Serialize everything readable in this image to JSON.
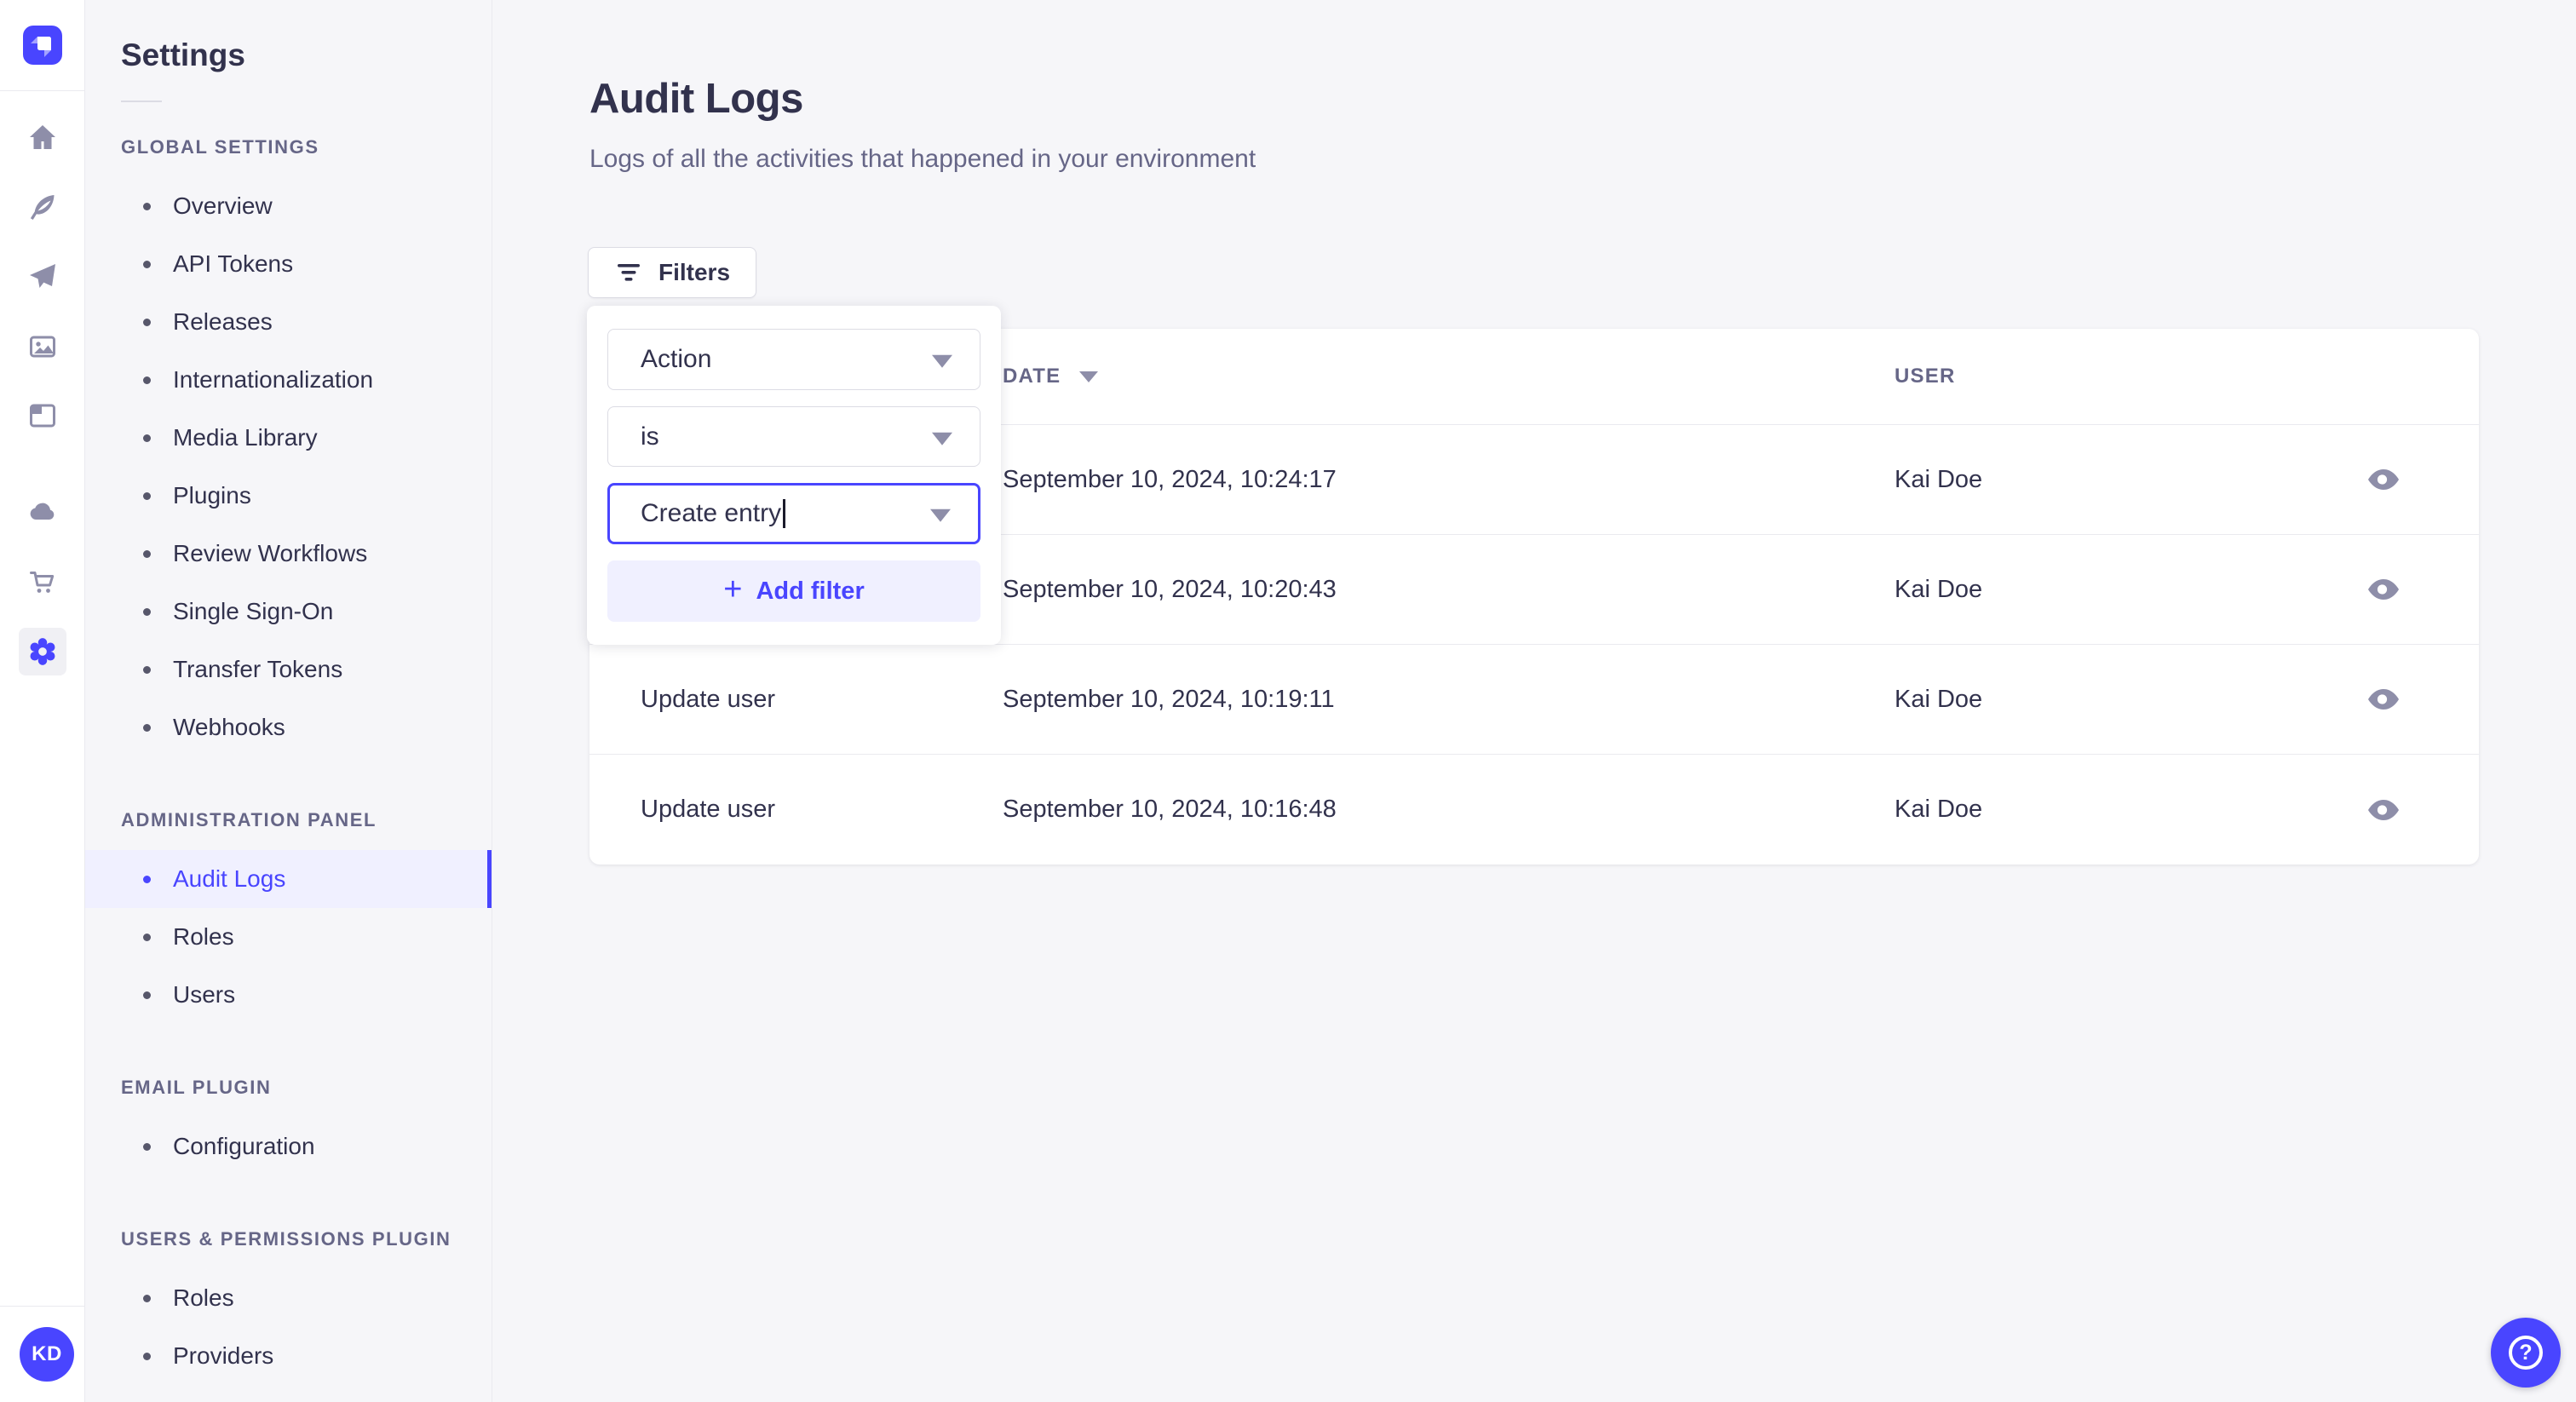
{
  "colors": {
    "accent": "#4945ff",
    "accent_light": "#f0f0ff",
    "text": "#32324d",
    "text_muted": "#666687",
    "border": "#dcdce4",
    "divider": "#eaeaef",
    "background": "#f6f6f9",
    "icon_gray": "#8e8ea9",
    "surface": "#ffffff"
  },
  "rail": {
    "logo_icon": "strapi-logo",
    "icons": [
      "home-icon",
      "feather-icon",
      "paper-plane-icon",
      "media-library-icon",
      "layout-icon",
      "cloud-icon",
      "cart-icon",
      "gear-icon"
    ],
    "active_icon": "gear-icon",
    "avatar_initials": "KD"
  },
  "sidebar": {
    "title": "Settings",
    "sections": [
      {
        "label": "GLOBAL SETTINGS",
        "items": [
          {
            "label": "Overview"
          },
          {
            "label": "API Tokens"
          },
          {
            "label": "Releases"
          },
          {
            "label": "Internationalization"
          },
          {
            "label": "Media Library"
          },
          {
            "label": "Plugins"
          },
          {
            "label": "Review Workflows"
          },
          {
            "label": "Single Sign-On"
          },
          {
            "label": "Transfer Tokens"
          },
          {
            "label": "Webhooks"
          }
        ]
      },
      {
        "label": "ADMINISTRATION PANEL",
        "items": [
          {
            "label": "Audit Logs",
            "active": true
          },
          {
            "label": "Roles"
          },
          {
            "label": "Users"
          }
        ]
      },
      {
        "label": "EMAIL PLUGIN",
        "items": [
          {
            "label": "Configuration"
          }
        ]
      },
      {
        "label": "USERS & PERMISSIONS PLUGIN",
        "items": [
          {
            "label": "Roles"
          },
          {
            "label": "Providers"
          }
        ]
      }
    ]
  },
  "main": {
    "title": "Audit Logs",
    "subtitle": "Logs of all the activities that happened in your environment",
    "filters_label": "Filters"
  },
  "filter_popover": {
    "field_value": "Action",
    "operator_value": "is",
    "value_value": "Create entry",
    "add_filter_label": "Add filter"
  },
  "table": {
    "headers": {
      "date": "DATE",
      "user": "USER"
    },
    "sorted_column": "DATE",
    "rows": [
      {
        "action": "",
        "date": "September 10, 2024, 10:24:17",
        "user": "Kai Doe"
      },
      {
        "action": "",
        "date": "September 10, 2024, 10:20:43",
        "user": "Kai Doe"
      },
      {
        "action": "Update user",
        "date": "September 10, 2024, 10:19:11",
        "user": "Kai Doe"
      },
      {
        "action": "Update user",
        "date": "September 10, 2024, 10:16:48",
        "user": "Kai Doe"
      }
    ]
  },
  "help": {
    "label": "?"
  }
}
